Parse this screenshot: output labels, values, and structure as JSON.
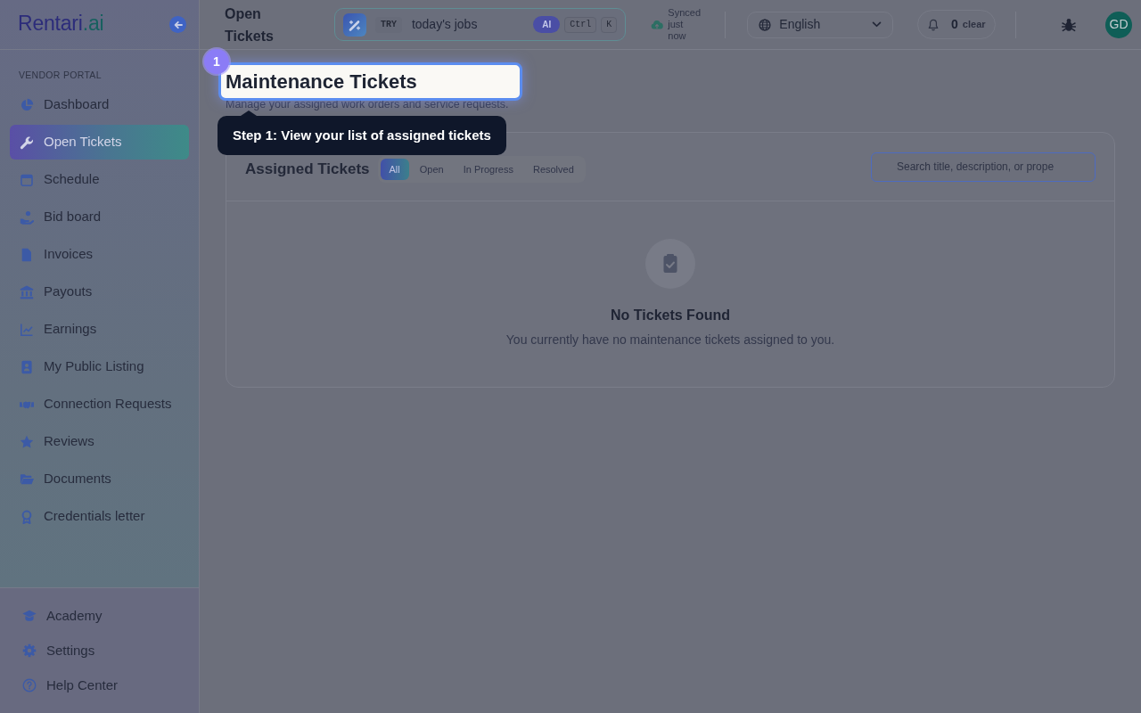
{
  "sidebar": {
    "logo": {
      "name": "Rentari",
      "suffix": ".ai"
    },
    "section_label": "VENDOR PORTAL",
    "items": [
      {
        "label": "Dashboard",
        "selected": false
      },
      {
        "label": "Open Tickets",
        "selected": true
      },
      {
        "label": "Schedule",
        "selected": false
      },
      {
        "label": "Bid board",
        "selected": false
      },
      {
        "label": "Invoices",
        "selected": false
      },
      {
        "label": "Payouts",
        "selected": false
      },
      {
        "label": "Earnings",
        "selected": false
      },
      {
        "label": "My Public Listing",
        "selected": false
      },
      {
        "label": "Connection Requests",
        "selected": false
      },
      {
        "label": "Reviews",
        "selected": false
      },
      {
        "label": "Documents",
        "selected": false
      },
      {
        "label": "Credentials letter",
        "selected": false
      }
    ],
    "footer_items": [
      {
        "label": "Academy"
      },
      {
        "label": "Settings"
      },
      {
        "label": "Help Center"
      }
    ]
  },
  "header": {
    "title": "Open Tickets",
    "command_bar": {
      "prefix": "TRY",
      "prompt": "today's jobs",
      "ai_tag": "AI",
      "shortcut_keys": [
        "Ctrl",
        "K"
      ]
    },
    "sync_status": "Synced just now",
    "language": "English",
    "notifications": {
      "count": "0",
      "action": "clear"
    },
    "avatar_initials": "GD"
  },
  "page": {
    "title": "Maintenance Tickets",
    "subtitle": "Manage your assigned work orders and service requests."
  },
  "tour": {
    "step": "1",
    "text": "Step 1: View your list of assigned tickets"
  },
  "tickets_card": {
    "title": "Assigned Tickets",
    "filters": [
      {
        "label": "All",
        "selected": true
      },
      {
        "label": "Open",
        "selected": false
      },
      {
        "label": "In Progress",
        "selected": false
      },
      {
        "label": "Resolved",
        "selected": false
      }
    ],
    "search": {
      "placeholder": "Search title, description, or prope"
    },
    "empty_state": {
      "title": "No Tickets Found",
      "message": "You currently have no maintenance tickets assigned to you."
    }
  }
}
